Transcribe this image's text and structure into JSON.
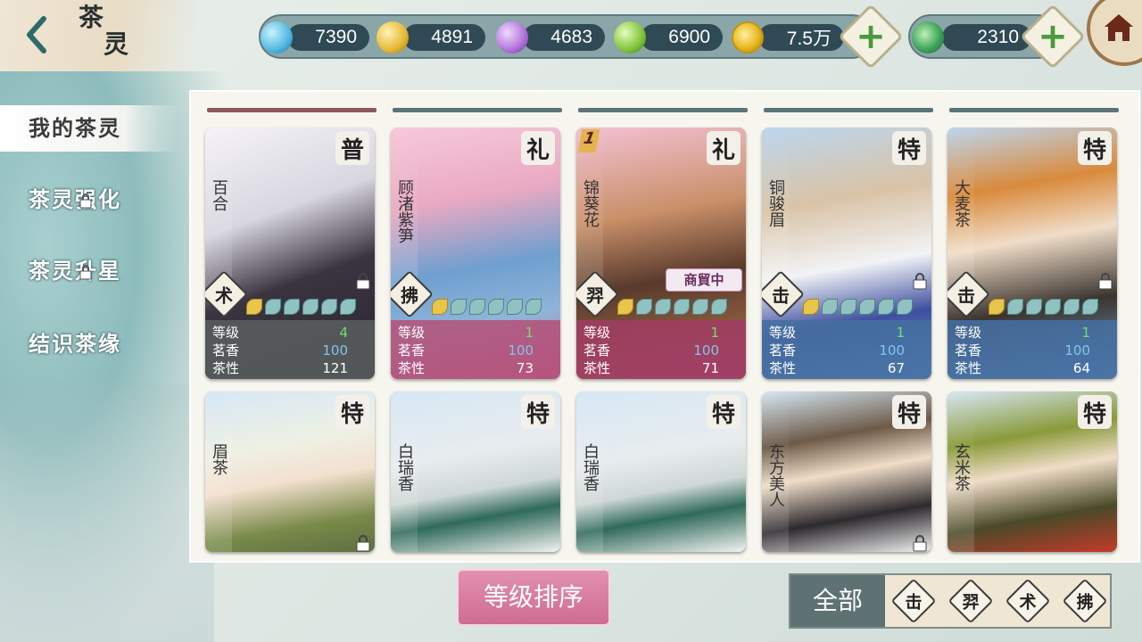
{
  "header": {
    "back_icon": "back-arrow-icon",
    "title_line1": "茶",
    "title_line2": "灵"
  },
  "currencies": [
    {
      "name": "blue-gem",
      "value": "7390",
      "color": "#4fb8e0"
    },
    {
      "name": "gold-gem",
      "value": "4891",
      "color": "#e6b830"
    },
    {
      "name": "purple-gem",
      "value": "4683",
      "color": "#b072d8"
    },
    {
      "name": "green-gem",
      "value": "6900",
      "color": "#7fc23a"
    },
    {
      "name": "gold-coin",
      "value": "7.5万",
      "color": "#e8b920"
    }
  ],
  "jade": {
    "name": "jade-token",
    "value": "2310",
    "color": "#3fa55c"
  },
  "plus_label": "+",
  "menu": [
    {
      "label": "我的茶灵"
    },
    {
      "label": "茶灵强化"
    },
    {
      "label": "茶灵升星"
    },
    {
      "label": "结识茶缘"
    }
  ],
  "stat_labels": {
    "level": "等级",
    "aroma": "茗香",
    "nature": "茶性"
  },
  "cards_row1": [
    {
      "name": "百合",
      "rank": "普",
      "type": "术",
      "level": "4",
      "aroma": "100",
      "nature": "121",
      "bg": "#8d9591"
    },
    {
      "name": "顾渚紫笋",
      "rank": "礼",
      "type": "拂",
      "level": "1",
      "aroma": "100",
      "nature": "73",
      "bg": "#c76a91"
    },
    {
      "name": "锦葵花",
      "rank": "礼",
      "type": "羿",
      "level": "1",
      "aroma": "100",
      "nature": "71",
      "bg": "#b8527c",
      "number": "1",
      "tag": "商貿中"
    },
    {
      "name": "铜骏眉",
      "rank": "特",
      "type": "击",
      "level": "1",
      "aroma": "100",
      "nature": "67",
      "bg": "#6b9fd0"
    },
    {
      "name": "大麦茶",
      "rank": "特",
      "type": "击",
      "level": "1",
      "aroma": "100",
      "nature": "64",
      "bg": "#6b9fd0"
    }
  ],
  "cards_row2": [
    {
      "name": "眉茶",
      "rank": "特",
      "bg": "#7fb4e0"
    },
    {
      "name": "白瑞香",
      "rank": "特",
      "bg": "#7fb4e0"
    },
    {
      "name": "白瑞香",
      "rank": "特",
      "bg": "#7fb4e0"
    },
    {
      "name": "东方美人",
      "rank": "特",
      "bg": "#7fb4e0"
    },
    {
      "name": "玄米茶",
      "rank": "特",
      "bg": "#7fb4e0"
    }
  ],
  "sort_button": "等级排序",
  "filter": {
    "all": "全部",
    "types": [
      "击",
      "羿",
      "术",
      "拂"
    ]
  }
}
